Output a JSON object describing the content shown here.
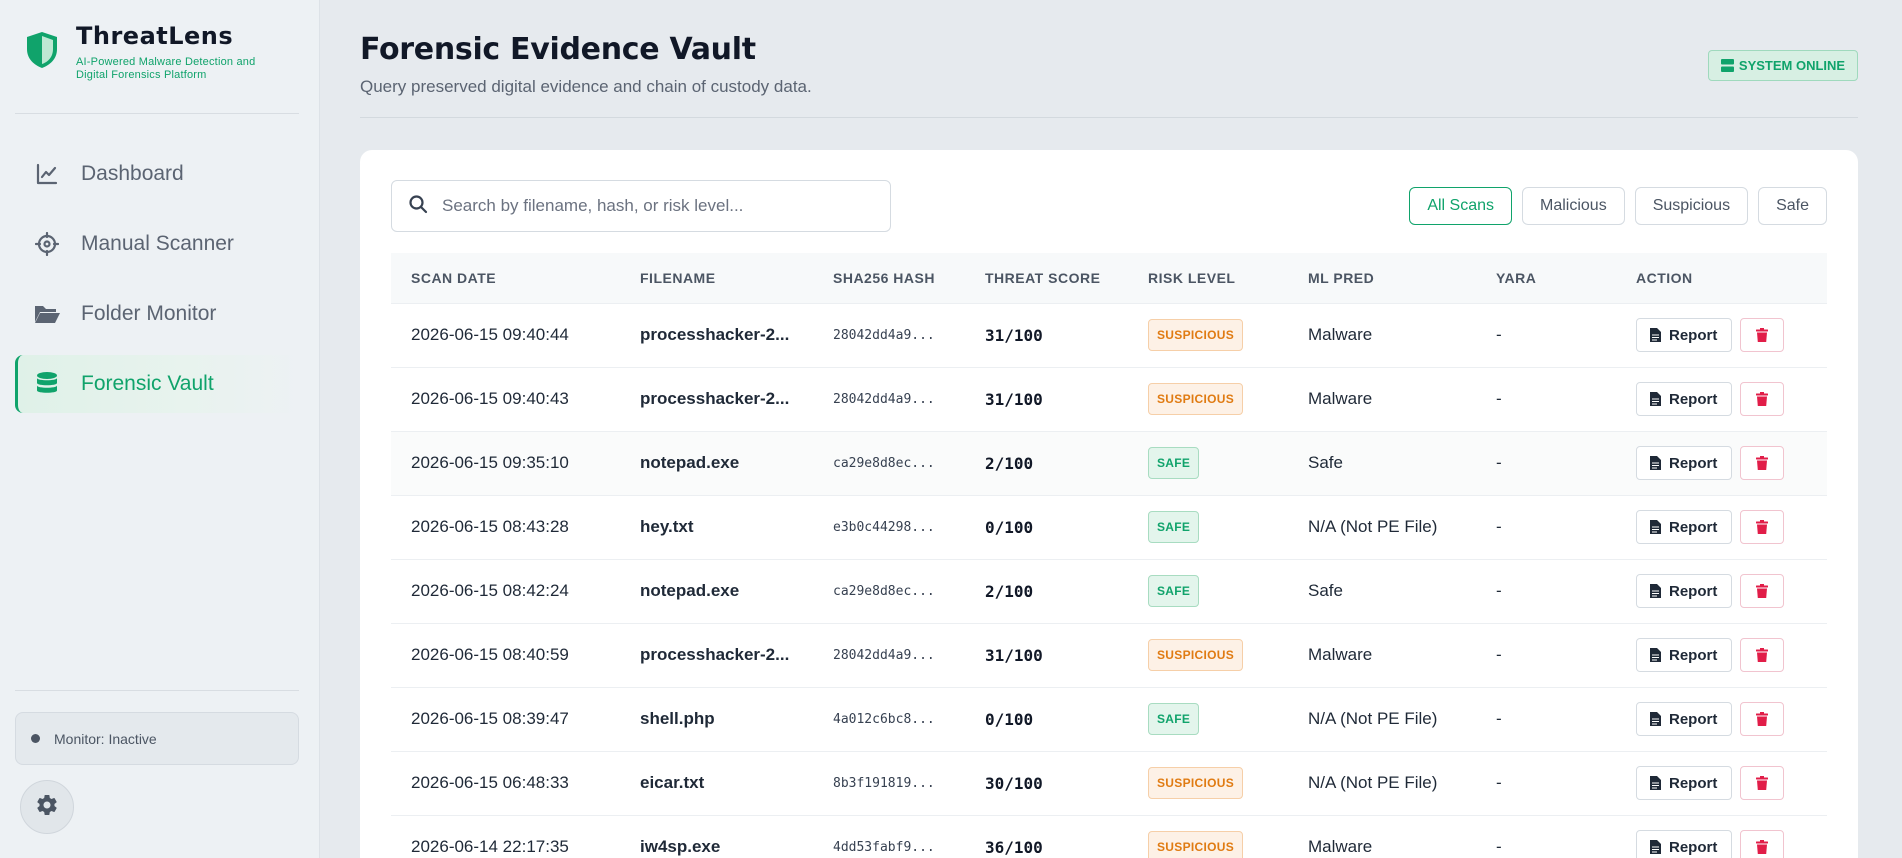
{
  "app": {
    "name": "ThreatLens",
    "tagline": "AI-Powered Malware Detection and Digital Forensics Platform"
  },
  "sidebar": {
    "items": [
      {
        "label": "Dashboard",
        "icon": "chart-line-icon"
      },
      {
        "label": "Manual Scanner",
        "icon": "crosshair-icon"
      },
      {
        "label": "Folder Monitor",
        "icon": "folder-open-icon"
      },
      {
        "label": "Forensic Vault",
        "icon": "database-icon",
        "active": true
      }
    ],
    "monitor_status": "Monitor: Inactive",
    "settings_icon": "gear-icon"
  },
  "header": {
    "title": "Forensic Evidence Vault",
    "subtitle": "Query preserved digital evidence and chain of custody data.",
    "status": "SYSTEM ONLINE"
  },
  "search": {
    "placeholder": "Search by filename, hash, or risk level...",
    "value": ""
  },
  "filters": [
    "All Scans",
    "Malicious",
    "Suspicious",
    "Safe"
  ],
  "active_filter": "All Scans",
  "table": {
    "columns": [
      "SCAN DATE",
      "FILENAME",
      "SHA256 HASH",
      "THREAT SCORE",
      "RISK LEVEL",
      "ML PRED",
      "YARA",
      "ACTION"
    ],
    "report_label": "Report",
    "rows": [
      {
        "date": "2026-06-15 09:40:44",
        "filename": "processhacker-2...",
        "hash": "28042dd4a9...",
        "score": "31/100",
        "risk": "SUSPICIOUS",
        "ml": "Malware",
        "yara": "-"
      },
      {
        "date": "2026-06-15 09:40:43",
        "filename": "processhacker-2...",
        "hash": "28042dd4a9...",
        "score": "31/100",
        "risk": "SUSPICIOUS",
        "ml": "Malware",
        "yara": "-"
      },
      {
        "date": "2026-06-15 09:35:10",
        "filename": "notepad.exe",
        "hash": "ca29e8d8ec...",
        "score": "2/100",
        "risk": "SAFE",
        "ml": "Safe",
        "yara": "-"
      },
      {
        "date": "2026-06-15 08:43:28",
        "filename": "hey.txt",
        "hash": "e3b0c44298...",
        "score": "0/100",
        "risk": "SAFE",
        "ml": "N/A (Not PE File)",
        "yara": "-"
      },
      {
        "date": "2026-06-15 08:42:24",
        "filename": "notepad.exe",
        "hash": "ca29e8d8ec...",
        "score": "2/100",
        "risk": "SAFE",
        "ml": "Safe",
        "yara": "-"
      },
      {
        "date": "2026-06-15 08:40:59",
        "filename": "processhacker-2...",
        "hash": "28042dd4a9...",
        "score": "31/100",
        "risk": "SUSPICIOUS",
        "ml": "Malware",
        "yara": "-"
      },
      {
        "date": "2026-06-15 08:39:47",
        "filename": "shell.php",
        "hash": "4a012c6bc8...",
        "score": "0/100",
        "risk": "SAFE",
        "ml": "N/A (Not PE File)",
        "yara": "-"
      },
      {
        "date": "2026-06-15 06:48:33",
        "filename": "eicar.txt",
        "hash": "8b3f191819...",
        "score": "30/100",
        "risk": "SUSPICIOUS",
        "ml": "N/A (Not PE File)",
        "yara": "-"
      },
      {
        "date": "2026-06-14 22:17:35",
        "filename": "iw4sp.exe",
        "hash": "4dd53fabf9...",
        "score": "36/100",
        "risk": "SUSPICIOUS",
        "ml": "Malware",
        "yara": "-"
      }
    ]
  },
  "colors": {
    "accent": "#10a36b",
    "suspicious": "#e07b12",
    "danger": "#e11d48"
  }
}
